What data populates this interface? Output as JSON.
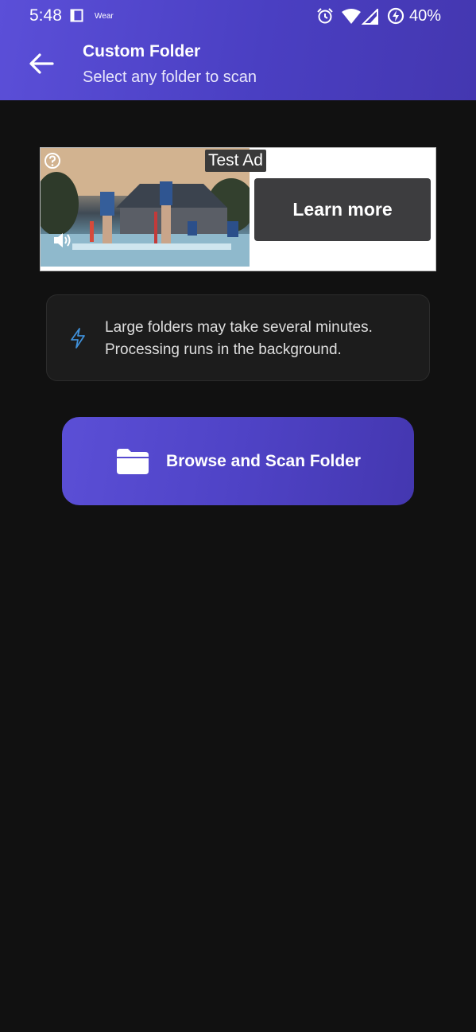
{
  "status_bar": {
    "time": "5:48",
    "wear_label": "Wear",
    "battery_percent": "40%"
  },
  "header": {
    "title": "Custom Folder",
    "subtitle": "Select any folder to scan"
  },
  "ad": {
    "badge": "Test Ad",
    "cta_label": "Learn more"
  },
  "info_card": {
    "line1": "Large folders may take several minutes.",
    "line2": "Processing runs in the background.",
    "icon": "lightning-bolt-icon",
    "icon_color": "#3f8fd8"
  },
  "scan_button": {
    "label": "Browse and Scan Folder",
    "icon": "folder-icon"
  },
  "colors": {
    "accent": "#5046c8",
    "background": "#111111"
  }
}
